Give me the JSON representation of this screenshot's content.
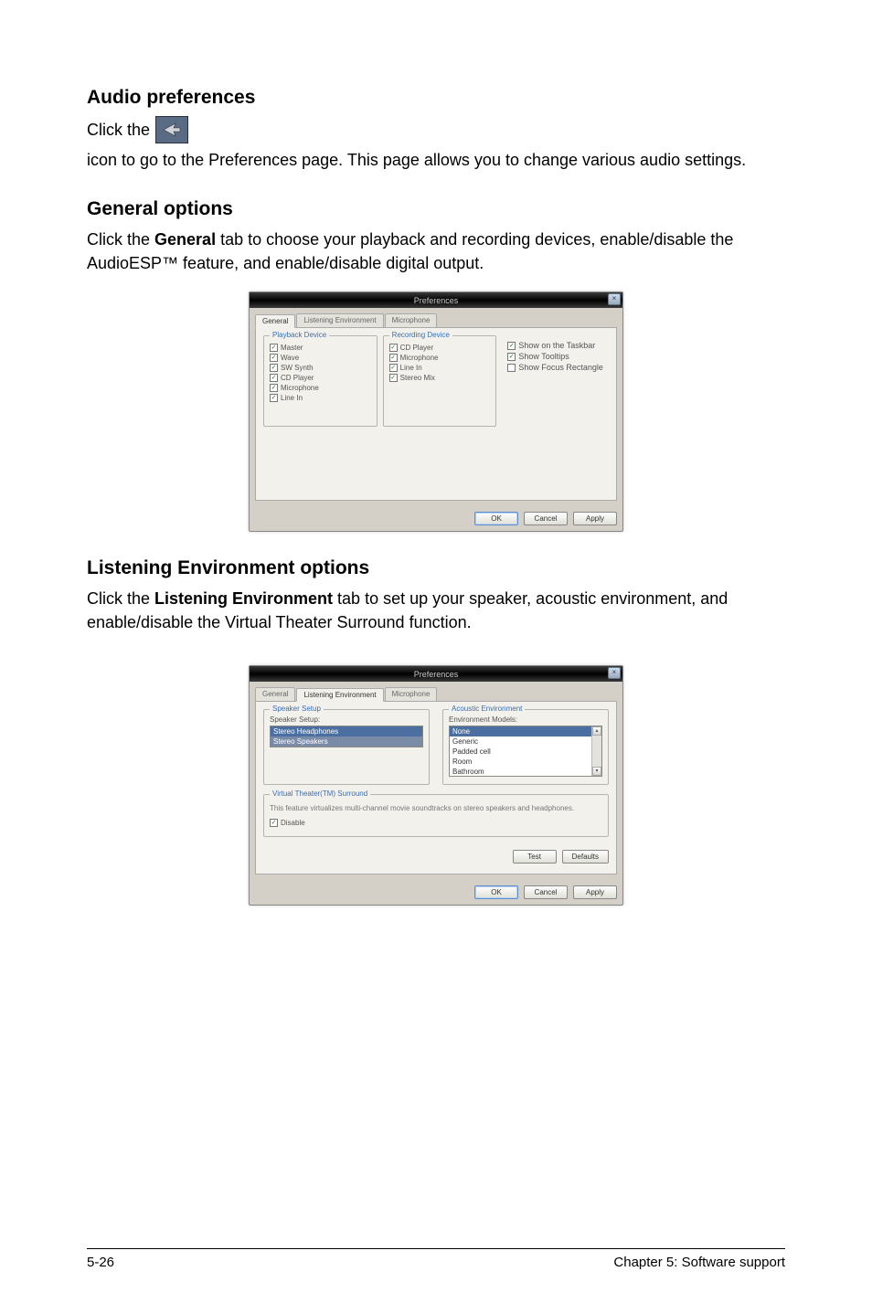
{
  "sections": {
    "audio_prefs": {
      "heading": "Audio preferences",
      "line_pre": "Click the ",
      "line_post": " icon to go to the Preferences page. This page allows you to change various audio settings."
    },
    "general": {
      "heading": "General options",
      "body_pre": "Click the ",
      "body_bold": "General",
      "body_post": " tab to choose your playback and recording devices, enable/disable the AudioESP™ feature, and enable/disable digital output."
    },
    "listening": {
      "heading": "Listening Environment options",
      "body_pre": "Click the ",
      "body_bold": "Listening Environment",
      "body_post": " tab to set up your speaker, acoustic environment, and enable/disable the Virtual Theater Surround function."
    }
  },
  "dialog1": {
    "title": "Preferences",
    "tabs": {
      "t0": "General",
      "t1": "Listening Environment",
      "t2": "Microphone"
    },
    "group_playback": "Playback Device",
    "group_recording": "Recording Device",
    "playback": [
      "Master",
      "Wave",
      "SW Synth",
      "CD Player",
      "Microphone",
      "Line In"
    ],
    "recording": [
      "CD Player",
      "Microphone",
      "Line In",
      "Stereo Mix"
    ],
    "right_opts": {
      "o1": "Show on the Taskbar",
      "o2": "Show Tooltips",
      "o3": "Show Focus Rectangle"
    },
    "buttons": {
      "ok": "OK",
      "cancel": "Cancel",
      "apply": "Apply"
    }
  },
  "dialog2": {
    "title": "Preferences",
    "tabs": {
      "t0": "General",
      "t1": "Listening Environment",
      "t2": "Microphone"
    },
    "speaker_setup": "Speaker Setup",
    "speaker_label": "Speaker Setup:",
    "speaker_opts": [
      "Stereo Headphones",
      "Stereo Speakers"
    ],
    "acoustic_env": "Acoustic Environment",
    "env_label": "Environment Models:",
    "env_opts": [
      "None",
      "Generic",
      "Padded cell",
      "Room",
      "Bathroom"
    ],
    "vt_group": "Virtual Theater(TM) Surround",
    "vt_desc": "This feature virtualizes multi-channel movie soundtracks on stereo speakers and headphones.",
    "vt_disable": "Disable",
    "buttons": {
      "test": "Test",
      "defaults": "Defaults",
      "ok": "OK",
      "cancel": "Cancel",
      "apply": "Apply"
    }
  },
  "footer": {
    "left": "5-26",
    "right": "Chapter 5: Software support"
  }
}
